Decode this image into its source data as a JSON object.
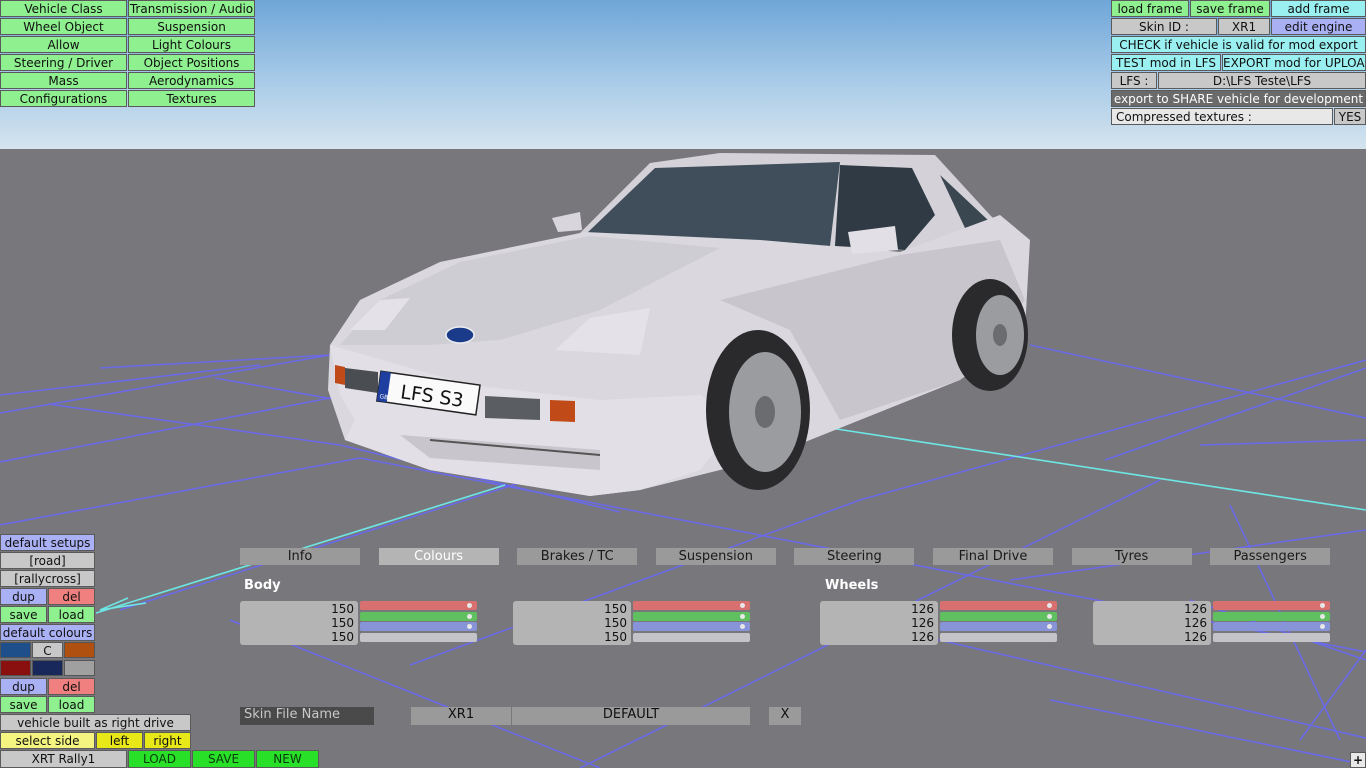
{
  "left_menu": [
    [
      "Vehicle Class",
      "Transmission / Audio"
    ],
    [
      "Wheel Object",
      "Suspension"
    ],
    [
      "Allow",
      "Light Colours"
    ],
    [
      "Steering / Driver",
      "Object Positions"
    ],
    [
      "Mass",
      "Aerodynamics"
    ],
    [
      "Configurations",
      "Textures"
    ]
  ],
  "right_panel": {
    "load_frame": "load frame",
    "save_frame": "save frame",
    "add_frame": "add frame",
    "skin_id_label": "Skin ID :",
    "skin_id_value": "XR1",
    "edit_engine": "edit engine",
    "check_valid": "CHECK if vehicle is valid for mod export",
    "test_mod": "TEST mod in LFS",
    "export_mod": "EXPORT mod for UPLOAD",
    "lfs_label": "LFS :",
    "lfs_path": "D:\\LFS Teste\\LFS",
    "export_share": "export to SHARE vehicle for development",
    "compressed_label": "Compressed textures :",
    "compressed_value": "YES"
  },
  "vehicle": {
    "plate": "LFS S3",
    "plate_flag": "GB"
  },
  "tabs": [
    "Info",
    "Colours",
    "Brakes / TC",
    "Suspension",
    "Steering",
    "Final Drive",
    "Tyres",
    "Passengers"
  ],
  "active_tab": "Colours",
  "colour_sections": {
    "body": "Body",
    "wheels": "Wheels"
  },
  "colour_boxes": [
    {
      "values": [
        "150",
        "150",
        "150"
      ]
    },
    {
      "values": [
        "150",
        "150",
        "150"
      ]
    },
    {
      "values": [
        "126",
        "126",
        "126"
      ]
    },
    {
      "values": [
        "126",
        "126",
        "126"
      ]
    }
  ],
  "slider_colors": {
    "red": "#d87070",
    "green": "#60c060",
    "blue": "#8894d8",
    "grey": "#c4c4c8"
  },
  "skin": {
    "label": "Skin File Name",
    "id": "XR1",
    "name": "DEFAULT",
    "clear": "X"
  },
  "bottom_left": {
    "default_setups": "default setups",
    "road": "[road]",
    "rallycross": "[rallycross]",
    "dup": "dup",
    "del": "del",
    "save": "save",
    "load": "load",
    "default_colours": "default colours",
    "c_button": "C",
    "swatch_colors": [
      "#1f4f8a",
      "#3a3a3a",
      "#b05010",
      "#8a1010",
      "#18285a",
      "#a0a0a0"
    ],
    "right_drive": "vehicle built as right drive",
    "select_side": "select side",
    "left": "left",
    "right": "right",
    "config_name": "XRT Rally1",
    "load_btn": "LOAD",
    "save_btn": "SAVE",
    "new_btn": "NEW"
  },
  "corner_plus": "+"
}
